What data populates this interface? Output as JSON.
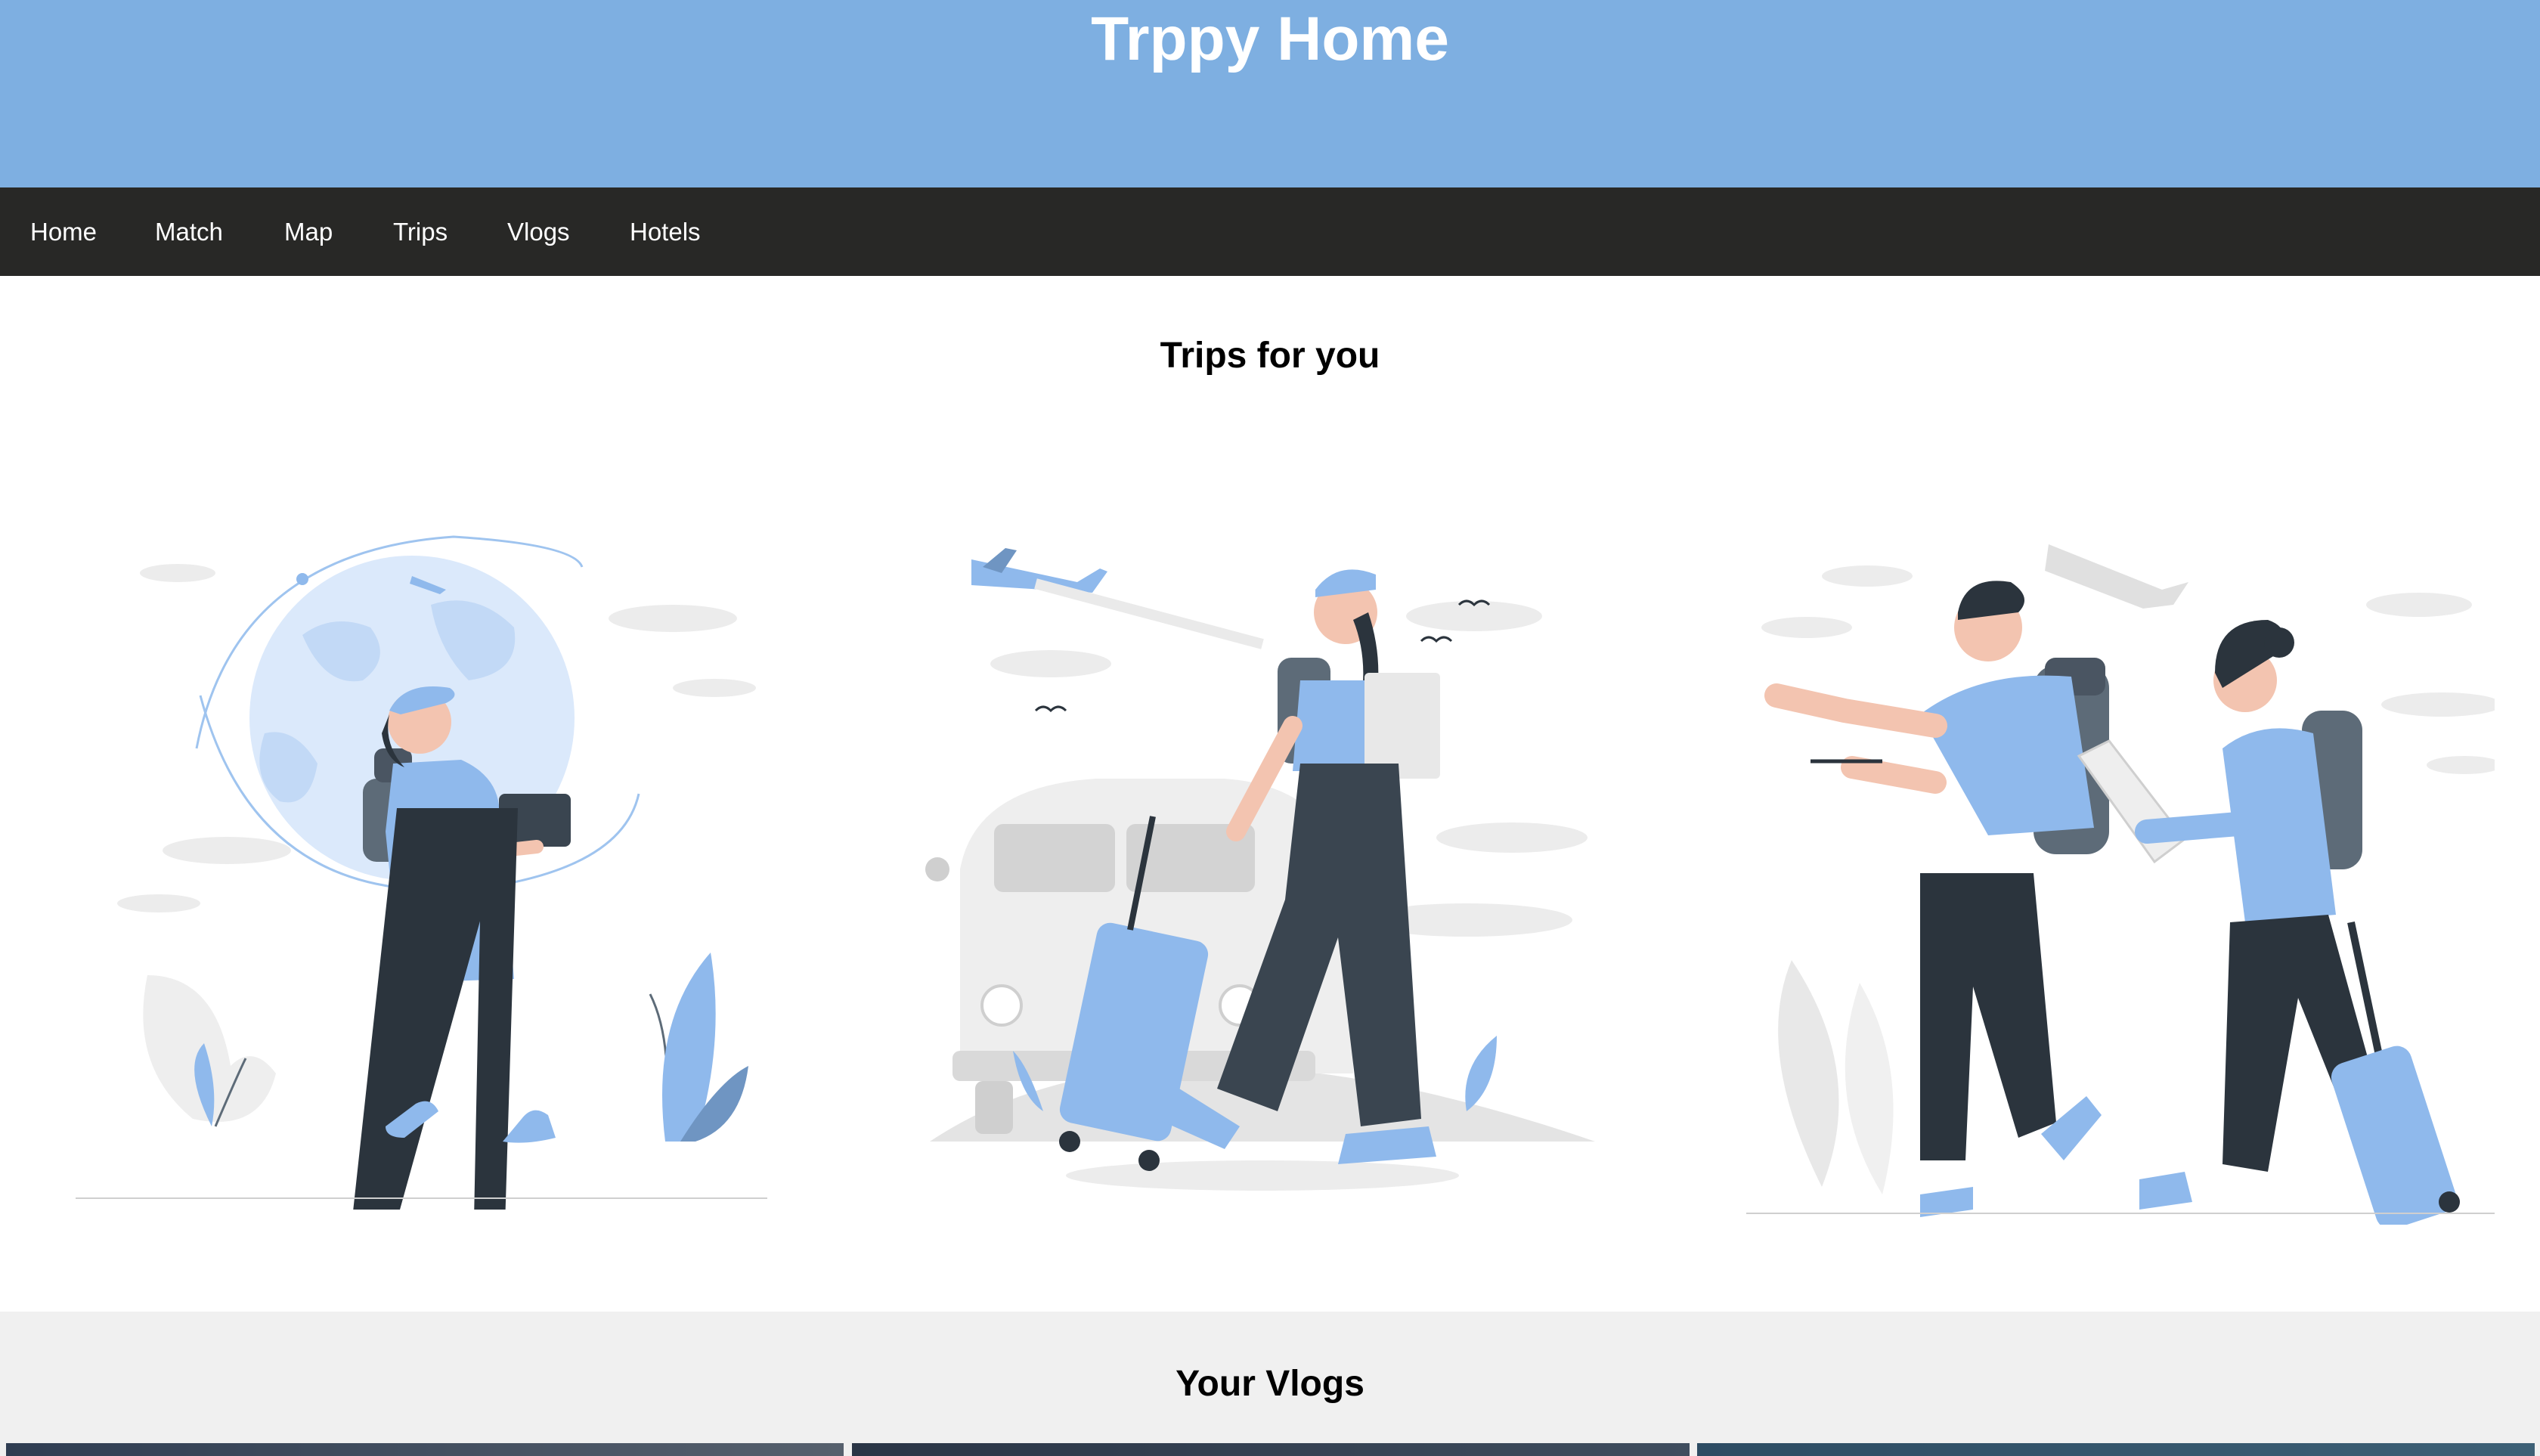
{
  "header": {
    "title": "Trppy Home",
    "background": "#7eafe1"
  },
  "nav": {
    "background": "#282826",
    "items": [
      "Home",
      "Match",
      "Map",
      "Trips",
      "Vlogs",
      "Hotels"
    ]
  },
  "trips": {
    "title": "Trips for you",
    "cards": [
      {
        "icon": "traveler-with-laptop-illustration"
      },
      {
        "icon": "traveler-with-suitcase-and-van-illustration"
      },
      {
        "icon": "couple-travelers-with-map-illustration"
      }
    ]
  },
  "vlogs": {
    "title": "Your Vlogs",
    "thumbnails": [
      {
        "icon": "vlog-thumbnail-image"
      },
      {
        "icon": "vlog-thumbnail-image"
      },
      {
        "icon": "vlog-thumbnail-image"
      }
    ]
  },
  "colors": {
    "accent_blue": "#8fb9ec",
    "dark_figure": "#2b343d",
    "light_gray": "#e4e4e4"
  }
}
